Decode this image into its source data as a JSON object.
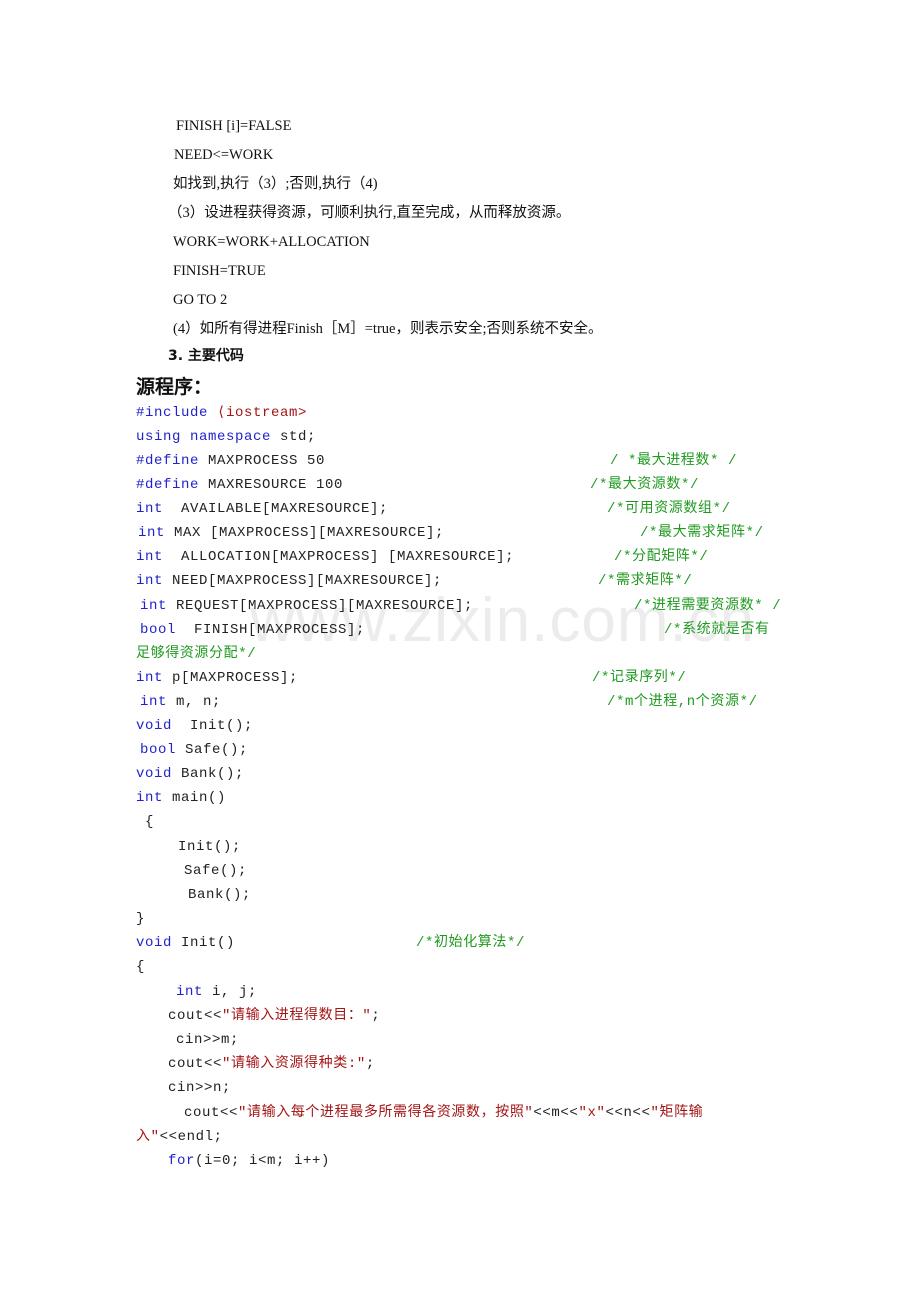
{
  "algorithm_steps": {
    "line1": "FINISH [i]=FALSE",
    "line2": "NEED<=WORK",
    "line3": "如找到,执行（3）;否则,执行（4)",
    "line4": "（3）设进程获得资源，可顺利执行,直至完成，从而释放资源。",
    "line5": "WORK=WORK+ALLOCATION",
    "line6": "FINISH=TRUE",
    "line7": "GO TO 2",
    "line8": "(4）如所有得进程Finish［M］=true，则表示安全;否则系统不安全。"
  },
  "section_heading": "3. 主要代码",
  "source_heading": "源程序：",
  "watermark": "www.zixin.com.cn",
  "code": {
    "l1_kw": "#include",
    "l1_str": " ⟨iostream>",
    "l2_kw": "using namespace",
    "l2_rest": " std;",
    "l3_kw": "#define",
    "l3_rest": " MAXPROCESS 50",
    "l3_cmt": "/ *最大进程数* /",
    "l4_kw": "#define",
    "l4_rest": " MAXRESOURCE 100",
    "l4_cmt": "/*最大资源数*/",
    "l5_kw": "int",
    "l5_rest": "  AVAILABLE[MAXRESOURCE];",
    "l5_cmt": "/*可用资源数组*/",
    "l6_kw": "int",
    "l6_rest": " MAX [MAXPROCESS][MAXRESOURCE];",
    "l6_cmt": "/*最大需求矩阵*/",
    "l7_kw": "int",
    "l7_rest": "  ALLOCATION[MAXPROCESS] [MAXRESOURCE];",
    "l7_cmt": "/*分配矩阵*/",
    "l8_kw": "int",
    "l8_rest": " NEED[MAXPROCESS][MAXRESOURCE];",
    "l8_cmt": "/*需求矩阵*/",
    "l9_kw": "int",
    "l9_rest": " REQUEST[MAXPROCESS][MAXRESOURCE];",
    "l9_cmt": "/*进程需要资源数* /",
    "l10_kw": "bool",
    "l10_rest": "  FINISH[MAXPROCESS];",
    "l10_cmt": "/*系统就是否有",
    "l11_cmt": "足够得资源分配*/",
    "l12_kw": "int",
    "l12_rest": " p[MAXPROCESS];",
    "l12_cmt": "/*记录序列*/",
    "l13_kw": "int",
    "l13_rest": " m, n;",
    "l13_cmt": "/*m个进程,n个资源*/",
    "l14_kw": "void",
    "l14_rest": "  Init();",
    "l15_kw": "bool",
    "l15_rest": " Safe();",
    "l16_kw": "void",
    "l16_rest": " Bank();",
    "l17_kw": "int",
    "l17_rest": " main()",
    "l18": " {",
    "l19": "Init();",
    "l20": "Safe();",
    "l21": "Bank();",
    "l22": "}",
    "l23_kw": "void",
    "l23_rest": " Init()",
    "l23_cmt": "/*初始化算法*/",
    "l24": "{",
    "l25_kw": "int",
    "l25_rest": " i, j;",
    "l26_a": "cout<<",
    "l26_str": "\"请输入进程得数目：\"",
    "l26_b": ";",
    "l27": "cin>>m;",
    "l28_a": "cout<<",
    "l28_str": "\"请输入资源得种类:\"",
    "l28_b": ";",
    "l29": "cin>>n;",
    "l30_a": "cout<<",
    "l30_str": "\"请输入每个进程最多所需得各资源数，按照\"",
    "l30_b": "<<m<<",
    "l30_str2": "\"x\"",
    "l30_c": "<<n<<",
    "l30_str3": "\"矩阵输",
    "l31_str": "入\"",
    "l31_b": "<<endl;",
    "l32_kw": "for",
    "l32_rest": "(i=0; i<m; i++)"
  }
}
